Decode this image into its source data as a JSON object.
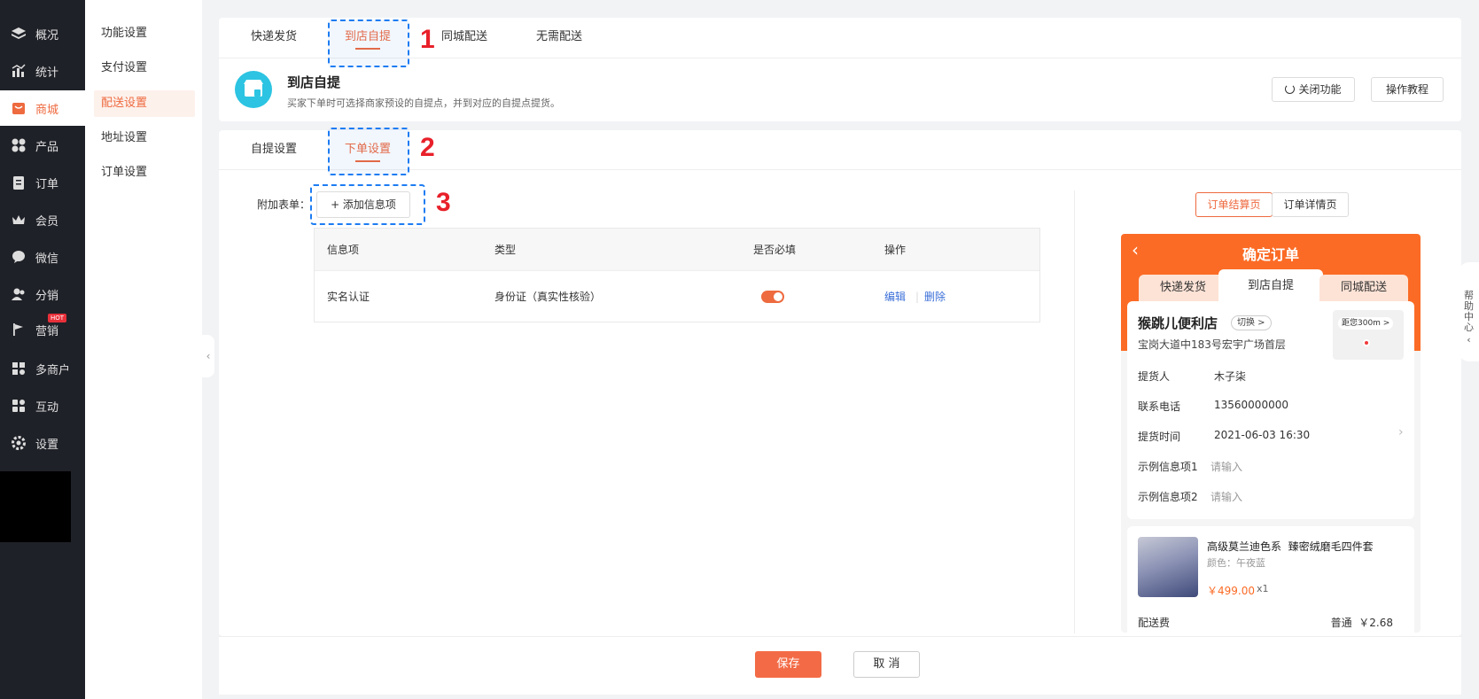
{
  "nav": {
    "items": [
      {
        "label": "概况",
        "icon": "layers-icon"
      },
      {
        "label": "统计",
        "icon": "chart-icon"
      },
      {
        "label": "商城",
        "icon": "shop-icon",
        "active": true
      },
      {
        "label": "产品",
        "icon": "grid-icon"
      },
      {
        "label": "订单",
        "icon": "clipboard-icon"
      },
      {
        "label": "会员",
        "icon": "crown-icon"
      },
      {
        "label": "微信",
        "icon": "wechat-icon"
      },
      {
        "label": "分销",
        "icon": "users-icon"
      },
      {
        "label": "营销",
        "icon": "flag-icon",
        "badge": "HOT"
      },
      {
        "label": "多商户",
        "icon": "store-icon"
      },
      {
        "label": "互动",
        "icon": "interact-icon"
      },
      {
        "label": "设置",
        "icon": "gear-icon"
      }
    ]
  },
  "subnav": {
    "items": [
      {
        "label": "功能设置"
      },
      {
        "label": "支付设置"
      },
      {
        "label": "配送设置",
        "active": true
      },
      {
        "label": "地址设置"
      },
      {
        "label": "订单设置"
      }
    ]
  },
  "delivery_tabs": [
    "快递发货",
    "到店自提",
    "同城配送",
    "无需配送"
  ],
  "feature": {
    "title": "到店自提",
    "desc": "买家下单时可选择商家预设的自提点，并到对应的自提点提货。",
    "close_btn": "关闭功能",
    "tutorial_btn": "操作教程"
  },
  "setting_tabs": [
    "自提设置",
    "下单设置"
  ],
  "annotations": [
    "1",
    "2",
    "3"
  ],
  "form": {
    "label": "附加表单：",
    "add_btn": "+ 添加信息项",
    "headers": [
      "信息项",
      "类型",
      "是否必填",
      "操作"
    ],
    "rows": [
      {
        "name": "实名认证",
        "type": "身份证（真实性核验）",
        "required": true,
        "edit": "编辑",
        "delete": "删除"
      }
    ]
  },
  "preview": {
    "tabs": [
      "订单结算页",
      "订单详情页"
    ],
    "title": "确定订单",
    "phone_tabs": [
      "快递发货",
      "到店自提",
      "同城配送"
    ],
    "store": "猴跳儿便利店",
    "switch": "切换 >",
    "distance": "距您300m >",
    "address": "宝岗大道中183号宏宇广场首层",
    "fields": [
      {
        "label": "提货人",
        "value": "木子柒"
      },
      {
        "label": "联系电话",
        "value": "13560000000"
      },
      {
        "label": "提货时间",
        "value": "2021-06-03 16:30"
      }
    ],
    "extras": [
      {
        "label": "示例信息项1",
        "placeholder": "请输入"
      },
      {
        "label": "示例信息项2",
        "placeholder": "请输入"
      }
    ],
    "product": {
      "name": "高级莫兰迪色系  臻密绒磨毛四件套",
      "spec": "颜色：午夜蓝",
      "price": "￥499.00",
      "qty": "x1"
    },
    "shipping": {
      "label": "配送费",
      "value": "普通  ￥2.68"
    }
  },
  "footer": {
    "save": "保存",
    "cancel": "取 消"
  },
  "help": "帮助中心",
  "colors": {
    "accent": "#ee6a3f",
    "annotation": "#e8202a",
    "dash": "#1d7cf2",
    "phone_header": "#fb6b25"
  }
}
